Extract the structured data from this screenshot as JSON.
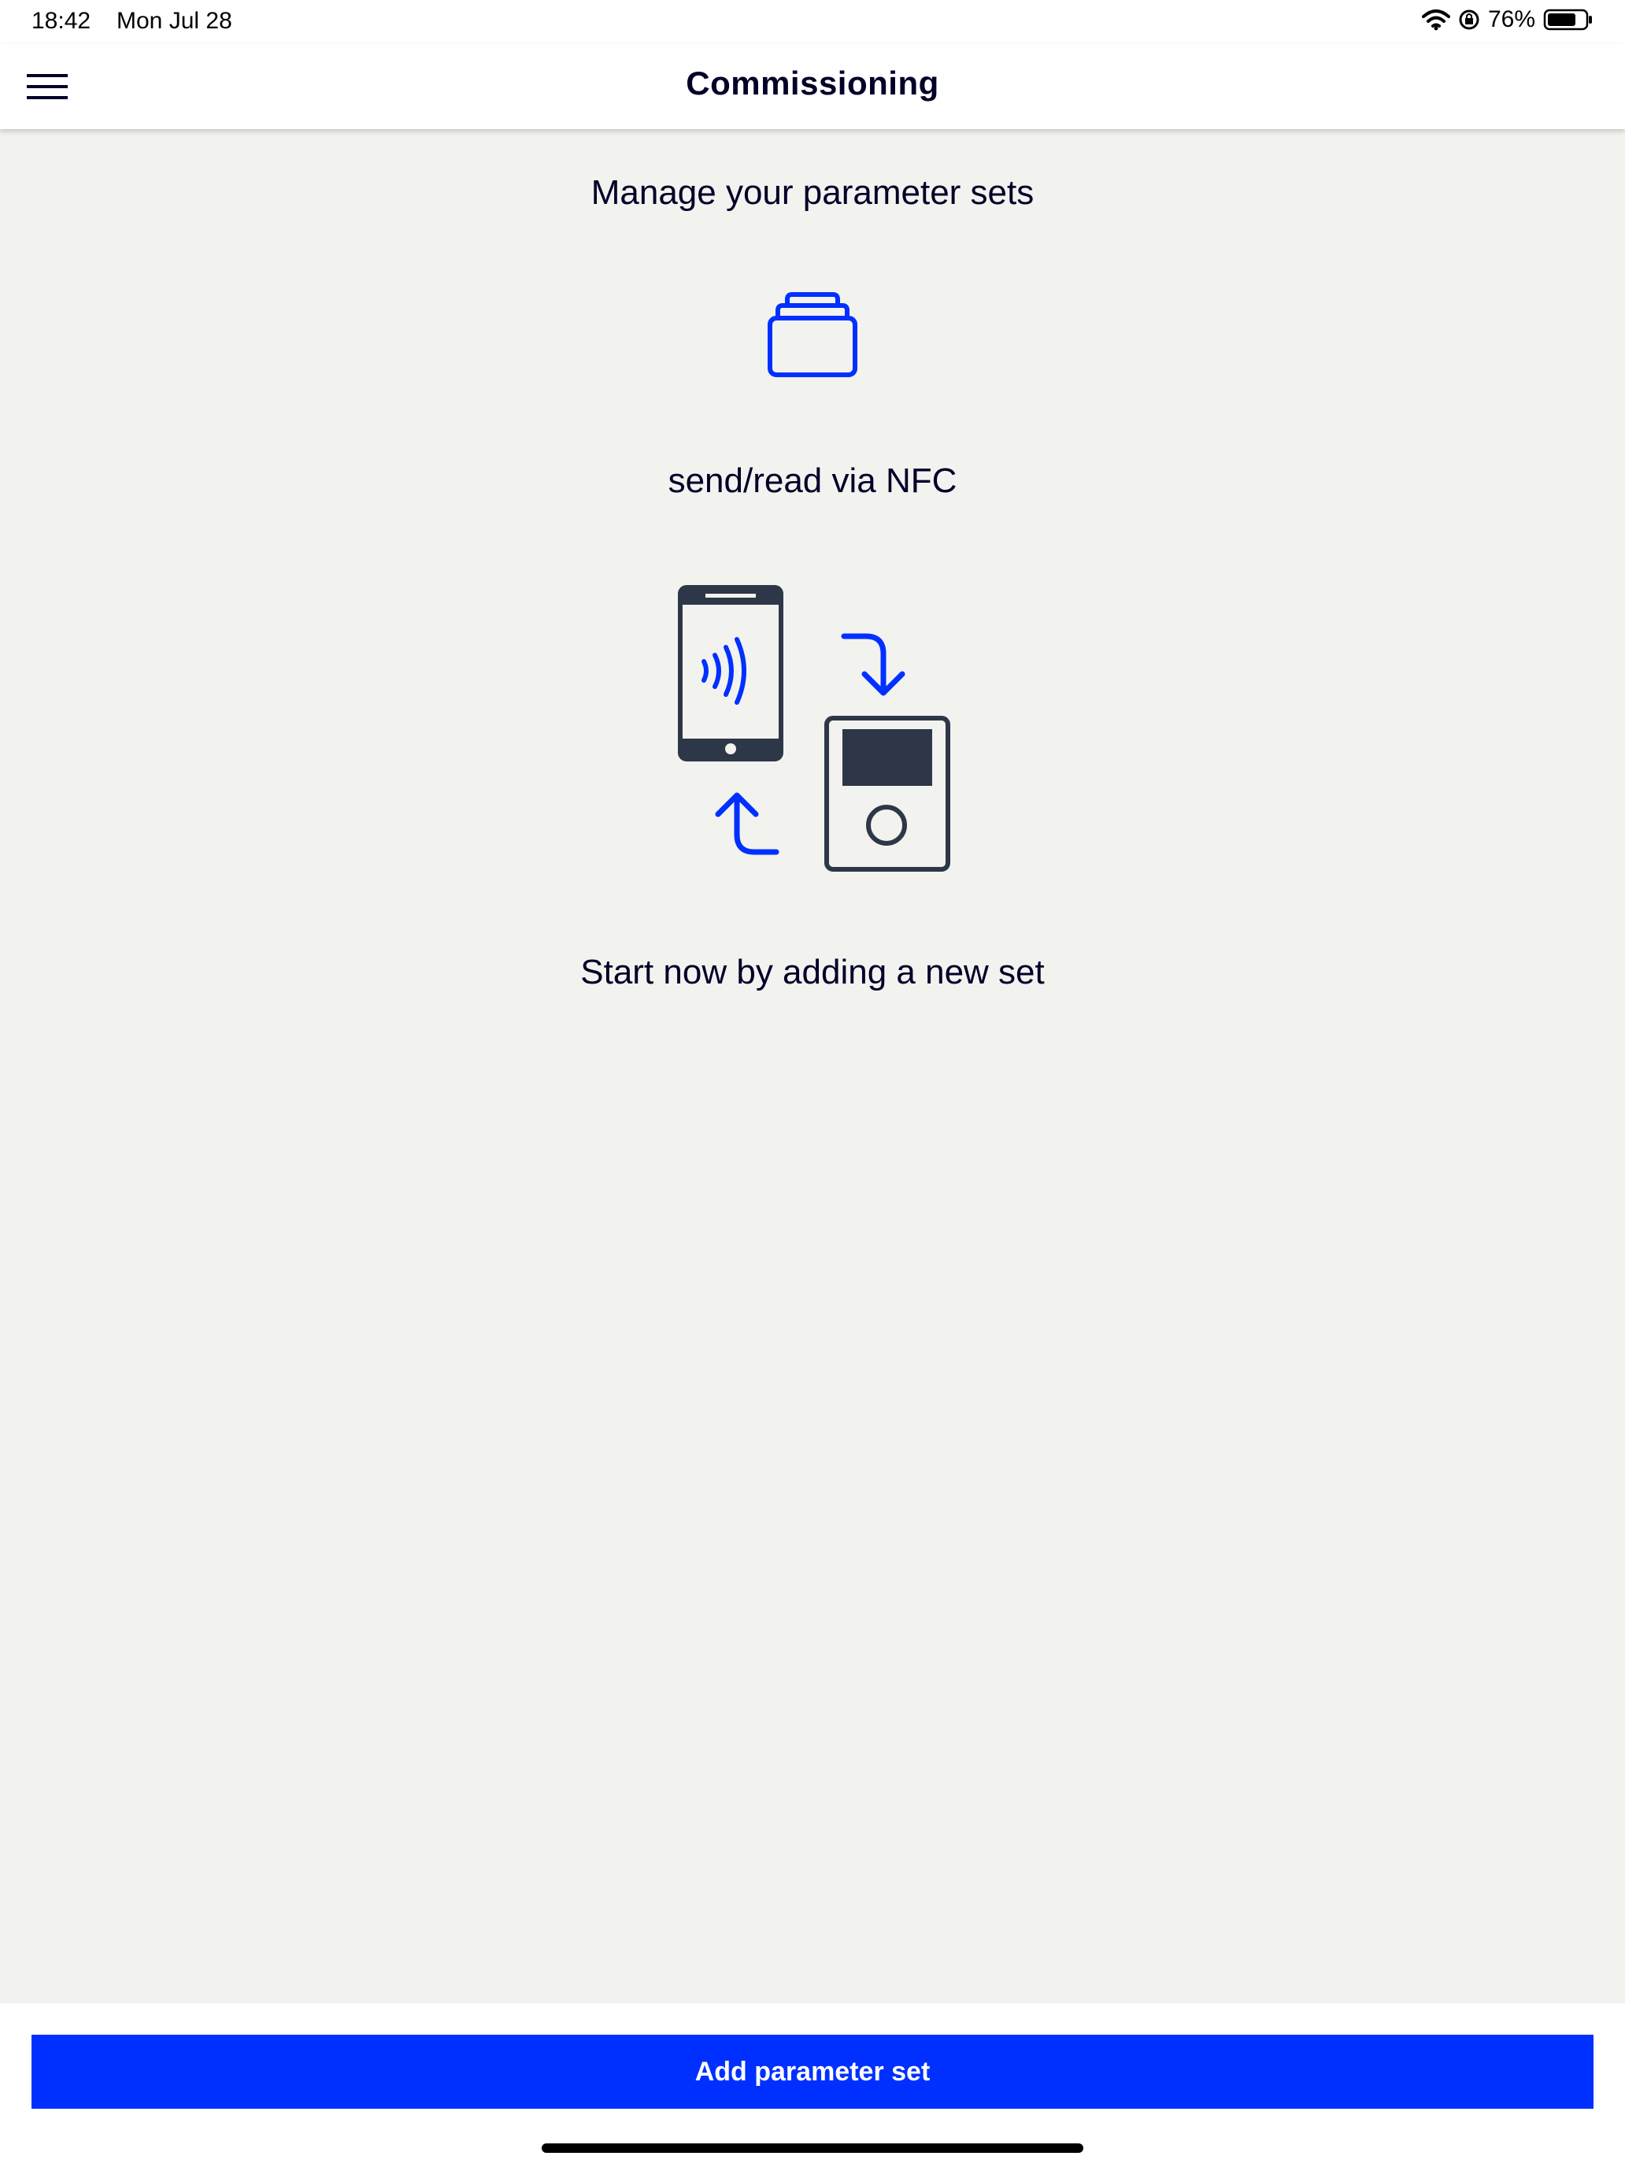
{
  "status_bar": {
    "time": "18:42",
    "date": "Mon Jul 28",
    "battery_percent": "76%",
    "battery_level": 0.76,
    "icons": [
      "wifi-icon",
      "orientation-lock-icon",
      "battery-icon"
    ]
  },
  "navbar": {
    "title": "Commissioning",
    "menu_icon": "hamburger-menu-icon"
  },
  "main": {
    "headline": "Manage your parameter sets",
    "nfc_label": "send/read via NFC",
    "cta_text": "Start now by adding a new set",
    "icons": [
      "parameter-sets-stack-icon",
      "nfc-phone-icon",
      "device-icon",
      "arrow-down-icon",
      "arrow-up-icon"
    ]
  },
  "footer": {
    "add_button_label": "Add parameter set"
  },
  "colors": {
    "accent": "#0030ff",
    "text": "#000028",
    "background": "#f2f2ef",
    "icon_dark": "#2d3748"
  }
}
